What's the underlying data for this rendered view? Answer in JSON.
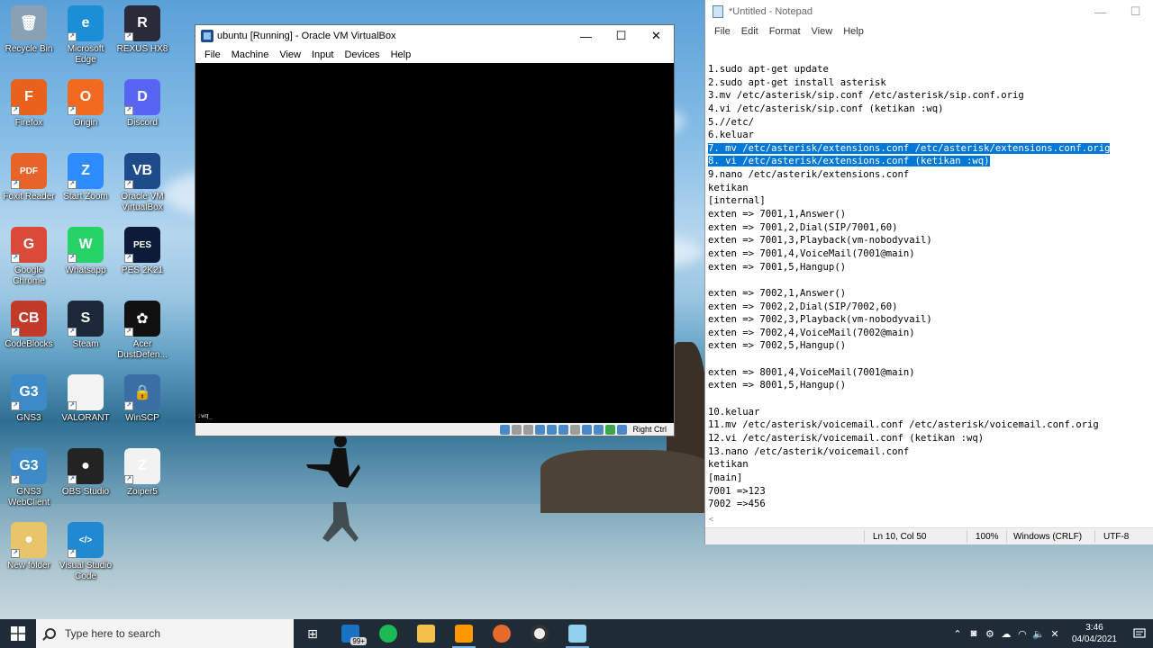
{
  "desktop": {
    "icons": [
      {
        "label": "Recycle Bin",
        "color": "#8aa0b4",
        "glyph": "🗑"
      },
      {
        "label": "Microsoft Edge",
        "color": "#1a8fd8",
        "glyph": "e"
      },
      {
        "label": "REXUS HX8",
        "color": "#2a2a3a",
        "glyph": "R"
      },
      {
        "label": "Firefox",
        "color": "#e8621e",
        "glyph": "F"
      },
      {
        "label": "Origin",
        "color": "#f26a20",
        "glyph": "O"
      },
      {
        "label": "Discord",
        "color": "#5865f2",
        "glyph": "D"
      },
      {
        "label": "Foxit Reader",
        "color": "#e8632a",
        "glyph": "PDF"
      },
      {
        "label": "Start Zoom",
        "color": "#2d8cff",
        "glyph": "Z"
      },
      {
        "label": "Oracle VM VirtualBox",
        "color": "#1e4c8a",
        "glyph": "VB"
      },
      {
        "label": "Google Chrome",
        "color": "#d94a38",
        "glyph": "G"
      },
      {
        "label": "Whatsapp",
        "color": "#25d366",
        "glyph": "W"
      },
      {
        "label": "PES 2K21",
        "color": "#0d1a3a",
        "glyph": "PES"
      },
      {
        "label": "CodeBlocks",
        "color": "#c23a2a",
        "glyph": "CB"
      },
      {
        "label": "Steam",
        "color": "#1b2838",
        "glyph": "S"
      },
      {
        "label": "Acer DustDefen...",
        "color": "#111111",
        "glyph": "✿"
      },
      {
        "label": "GNS3",
        "color": "#3d8ac8",
        "glyph": "G3"
      },
      {
        "label": "VALORANT",
        "color": "#f4f4f4",
        "glyph": ""
      },
      {
        "label": "WinSCP",
        "color": "#3a6ea5",
        "glyph": "🔒"
      },
      {
        "label": "GNS3 WebClient",
        "color": "#3d8ac8",
        "glyph": "G3"
      },
      {
        "label": "OBS Studio",
        "color": "#232323",
        "glyph": "●"
      },
      {
        "label": "Zoiper5",
        "color": "#f2f2f2",
        "glyph": "Z"
      },
      {
        "label": "New folder",
        "color": "#e8c46a",
        "glyph": "●"
      },
      {
        "label": "Visual Studio Code",
        "color": "#1f8ad2",
        "glyph": "</>"
      }
    ]
  },
  "vbox": {
    "title": "ubuntu [Running] - Oracle VM VirtualBox",
    "menu": [
      "File",
      "Machine",
      "View",
      "Input",
      "Devices",
      "Help"
    ],
    "screen_text": ":wq_",
    "host_key": "Right Ctrl",
    "minimize": "—",
    "maximize": "☐",
    "close": "✕"
  },
  "notepad": {
    "title": "*Untitled - Notepad",
    "menu": [
      "File",
      "Edit",
      "Format",
      "View",
      "Help"
    ],
    "minimize": "—",
    "maximize": "☐",
    "lines": [
      "1.sudo apt-get update",
      "2.sudo apt-get install asterisk",
      "3.mv /etc/asterisk/sip.conf /etc/asterisk/sip.conf.orig",
      "4.vi /etc/asterisk/sip.conf (ketikan :wq)",
      "5.//etc/",
      "6.keluar",
      "7. mv /etc/asterisk/extensions.conf /etc/asterisk/extensions.conf.orig",
      "8. vi /etc/asterisk/extensions.conf (ketikan :wq)",
      "9.nano /etc/asterik/extensions.conf",
      "ketikan",
      "[internal]",
      "exten => 7001,1,Answer()",
      "exten => 7001,2,Dial(SIP/7001,60)",
      "exten => 7001,3,Playback(vm-nobodyvail)",
      "exten => 7001,4,VoiceMail(7001@main)",
      "exten => 7001,5,Hangup()",
      "",
      "exten => 7002,1,Answer()",
      "exten => 7002,2,Dial(SIP/7002,60)",
      "exten => 7002,3,Playback(vm-nobodyvail)",
      "exten => 7002,4,VoiceMail(7002@main)",
      "exten => 7002,5,Hangup()",
      "",
      "exten => 8001,4,VoiceMail(7001@main)",
      "exten => 8001,5,Hangup()",
      "",
      "10.keluar",
      "11.mv /etc/asterisk/voicemail.conf /etc/asterisk/voicemail.conf.orig",
      "12.vi /etc/asterisk/voicemail.conf (ketikan :wq)",
      "13.nano /etc/asterik/voicemail.conf",
      "ketikan",
      "[main]",
      "7001 =>123",
      "7002 =>456"
    ],
    "highlighted_lines": [
      6,
      7
    ],
    "status": {
      "position": "Ln 10, Col 50",
      "zoom": "100%",
      "line_ending": "Windows (CRLF)",
      "encoding": "UTF-8"
    }
  },
  "taskbar": {
    "search_placeholder": "Type here to search",
    "mail_badge": "99+",
    "time": "3:46",
    "date": "04/04/2021"
  }
}
